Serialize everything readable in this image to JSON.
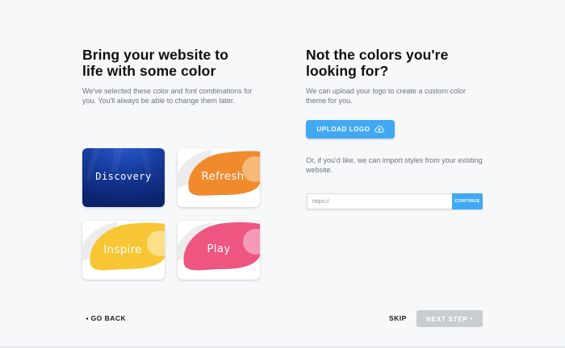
{
  "left": {
    "title_line1": "Bring your website to",
    "title_line2": "life with some color",
    "description": "We've selected these color and font combinations for you. You'll always be able to change them later."
  },
  "themes": [
    {
      "label": "Discovery",
      "color": "#153a9a"
    },
    {
      "label": "Refresh",
      "color": "#f08a2c"
    },
    {
      "label": "Inspire",
      "color": "#f8c634"
    },
    {
      "label": "Play",
      "color": "#ee5580"
    }
  ],
  "right": {
    "title_line1": "Not the colors you're",
    "title_line2": "looking for?",
    "description": "We can upload your logo to create a custom color theme for you.",
    "upload_label": "UPLOAD LOGO",
    "upload_icon": "cloud-upload-icon",
    "import_text": "Or, if you'd like, we can import styles from your existing website.",
    "url_placeholder": "https://",
    "continue_label": "CONTINUE"
  },
  "footer": {
    "back_arrow": "◂",
    "back_label": "GO BACK",
    "skip_label": "SKIP",
    "next_label": "NEXT STEP",
    "next_arrow": "▸"
  },
  "colors": {
    "accent": "#41a9f4",
    "disabled": "#c9ccd1",
    "background": "#f7f8fa"
  }
}
